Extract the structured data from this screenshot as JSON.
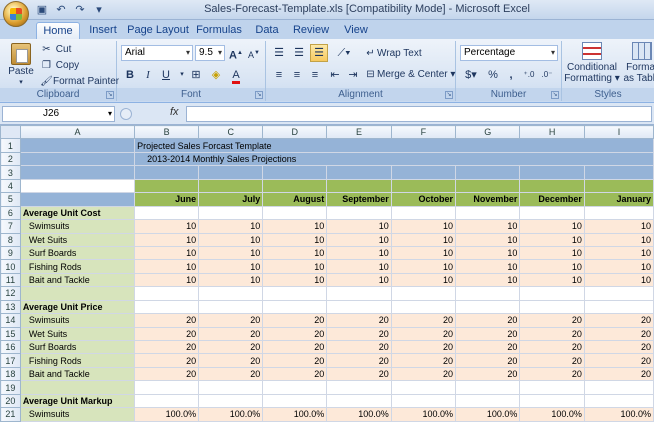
{
  "window": {
    "title": "Sales-Forecast-Template.xls  [Compatibility Mode] - Microsoft Excel"
  },
  "ribbon": {
    "tabs": [
      {
        "label": "Home",
        "active": true
      },
      {
        "label": "Insert"
      },
      {
        "label": "Page Layout"
      },
      {
        "label": "Formulas"
      },
      {
        "label": "Data"
      },
      {
        "label": "Review"
      },
      {
        "label": "View"
      }
    ],
    "clipboard": {
      "label": "Clipboard",
      "paste": "Paste",
      "cut": "Cut",
      "copy": "Copy",
      "format_painter": "Format Painter"
    },
    "font": {
      "label": "Font",
      "name": "Arial",
      "size": "9.5"
    },
    "alignment": {
      "label": "Alignment",
      "wrap_text": "Wrap Text",
      "merge_center": "Merge & Center"
    },
    "number": {
      "label": "Number",
      "format": "Percentage",
      "currency": "$",
      "percent": "%",
      "comma": ","
    },
    "styles": {
      "label": "Styles",
      "conditional": "Conditional",
      "formatting": "Formatting",
      "format_as": "Format",
      "as_table": "as Table"
    }
  },
  "formula_bar": {
    "name_box": "J26",
    "fx": "fx",
    "value": ""
  },
  "sheet": {
    "columns": [
      "A",
      "B",
      "C",
      "D",
      "E",
      "F",
      "G",
      "H",
      "I"
    ],
    "title": "Projected Sales Forcast Template",
    "subtitle": "2013-2014 Monthly Sales Projections",
    "months": [
      "June",
      "July",
      "August",
      "September",
      "October",
      "November",
      "December",
      "January"
    ],
    "sections": {
      "cost": "Average Unit Cost",
      "price": "Average Unit Price",
      "markup": "Average Unit Markup"
    },
    "products": [
      "Swimsuits",
      "Wet Suits",
      "Surf Boards",
      "Fishing Rods",
      "Bait and Tackle"
    ],
    "cost_values": [
      "10",
      "10",
      "10",
      "10",
      "10",
      "10",
      "10",
      "10"
    ],
    "price_values": [
      "20",
      "20",
      "20",
      "20",
      "20",
      "20",
      "20",
      "20"
    ],
    "markup_values": [
      "100.0%",
      "100.0%",
      "100.0%",
      "100.0%",
      "100.0%",
      "100.0%",
      "100.0%",
      "100.0%"
    ]
  },
  "colors": {
    "header_blue": "#95b3d7",
    "month_green": "#9bbb59",
    "label_sage": "#d7e4bc",
    "value_peach": "#fde9d9"
  }
}
